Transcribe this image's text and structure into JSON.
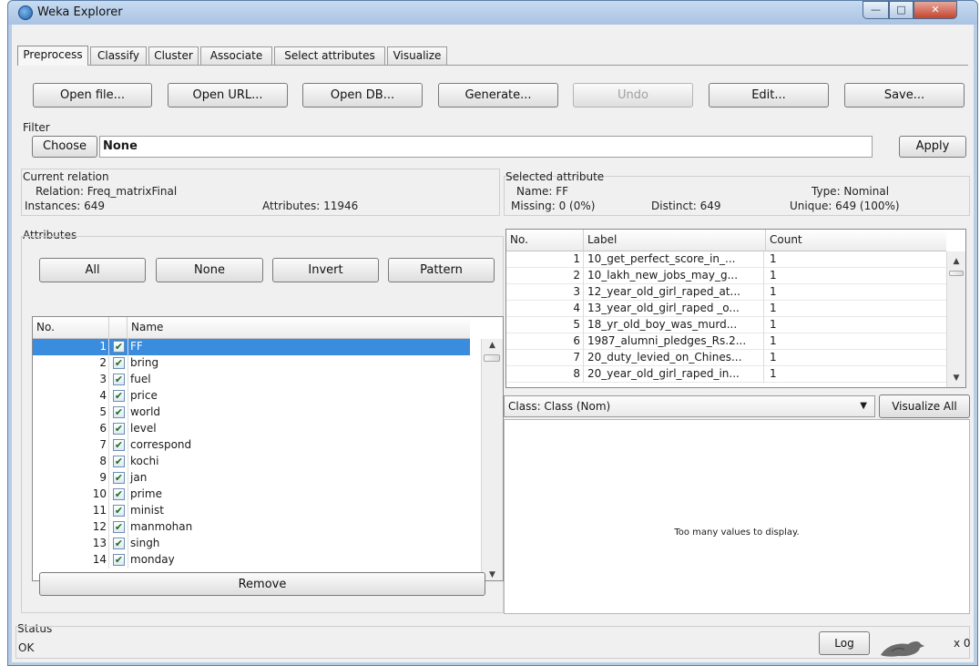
{
  "window": {
    "title": "Weka Explorer",
    "min": "—",
    "max": "□",
    "close": "✕"
  },
  "tabs": [
    "Preprocess",
    "Classify",
    "Cluster",
    "Associate",
    "Select attributes",
    "Visualize"
  ],
  "toolbar": {
    "open_file": "Open file...",
    "open_url": "Open URL...",
    "open_db": "Open DB...",
    "generate": "Generate...",
    "undo": "Undo",
    "edit": "Edit...",
    "save": "Save..."
  },
  "filter": {
    "label": "Filter",
    "choose": "Choose",
    "value": "None",
    "apply": "Apply"
  },
  "relation": {
    "title": "Current relation",
    "relation_label": "Relation: Freq_matrixFinal",
    "instances_label": "Instances: 649",
    "attributes_label": "Attributes: 11946"
  },
  "attributes": {
    "title": "Attributes",
    "buttons": {
      "all": "All",
      "none": "None",
      "invert": "Invert",
      "pattern": "Pattern"
    },
    "col_no": "No.",
    "col_name": "Name",
    "rows": [
      {
        "no": "1",
        "name": "FF"
      },
      {
        "no": "2",
        "name": "bring"
      },
      {
        "no": "3",
        "name": "fuel"
      },
      {
        "no": "4",
        "name": "price"
      },
      {
        "no": "5",
        "name": "world"
      },
      {
        "no": "6",
        "name": "level"
      },
      {
        "no": "7",
        "name": "correspond"
      },
      {
        "no": "8",
        "name": "kochi"
      },
      {
        "no": "9",
        "name": "jan"
      },
      {
        "no": "10",
        "name": "prime"
      },
      {
        "no": "11",
        "name": "minist"
      },
      {
        "no": "12",
        "name": "manmohan"
      },
      {
        "no": "13",
        "name": "singh"
      },
      {
        "no": "14",
        "name": "monday"
      }
    ],
    "remove": "Remove"
  },
  "selected": {
    "title": "Selected attribute",
    "name_label": "Name: FF",
    "type_label": "Type: Nominal",
    "missing_label": "Missing: 0 (0%)",
    "distinct_label": "Distinct: 649",
    "unique_label": "Unique: 649 (100%)",
    "col_no": "No.",
    "col_label": "Label",
    "col_count": "Count",
    "rows": [
      {
        "no": "1",
        "label": "10_get_perfect_score_in_...",
        "count": "1"
      },
      {
        "no": "2",
        "label": "10_lakh_new_jobs_may_g...",
        "count": "1"
      },
      {
        "no": "3",
        "label": "12_year_old_girl_raped_at...",
        "count": "1"
      },
      {
        "no": "4",
        "label": "13_year_old_girl_raped _o...",
        "count": "1"
      },
      {
        "no": "5",
        "label": "18_yr_old_boy_was_murd...",
        "count": "1"
      },
      {
        "no": "6",
        "label": "1987_alumni_pledges_Rs.2...",
        "count": "1"
      },
      {
        "no": "7",
        "label": "20_duty_levied_on_Chines...",
        "count": "1"
      },
      {
        "no": "8",
        "label": "20_year_old_girl_raped_in...",
        "count": "1"
      }
    ]
  },
  "class_select": {
    "value": "Class: Class (Nom)",
    "visualize_all": "Visualize All"
  },
  "viz_message": "Too many values to display.",
  "status": {
    "title": "Status",
    "text": "OK",
    "log": "Log",
    "tasks": "x 0"
  }
}
